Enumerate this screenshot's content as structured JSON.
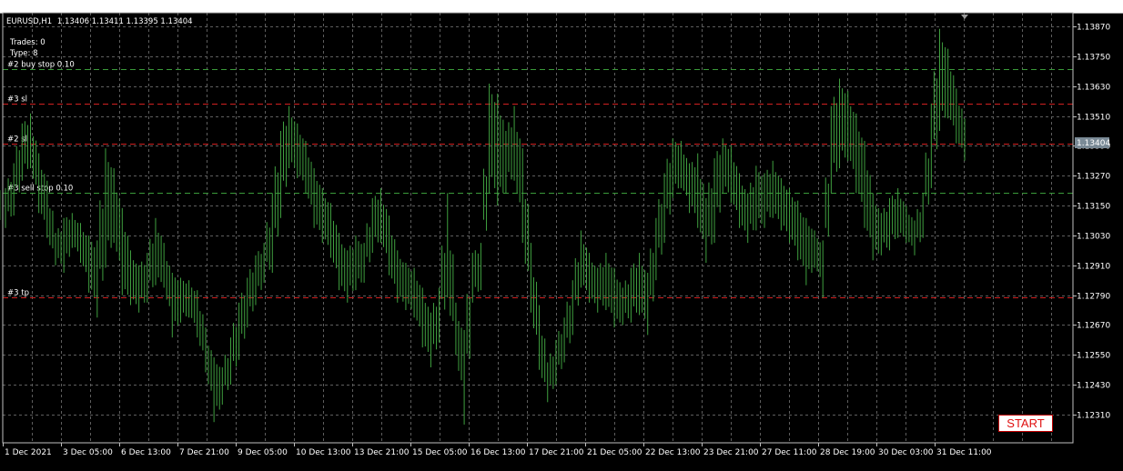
{
  "symbol_header": {
    "symbol": "EURUSD,H1",
    "ohlc": "1.13406 1.13411 1.13395 1.13404"
  },
  "info_lines": [
    "Trades: 0",
    "Type: 8"
  ],
  "levels": [
    {
      "label": "#2 buy stop 0.10",
      "price": 1.137,
      "color": "#3a9a3a",
      "show_label": true
    },
    {
      "label": "#3 sl",
      "price": 1.1356,
      "color": "#d02020",
      "show_label": true
    },
    {
      "label": "#2 sl",
      "price": 1.134,
      "color": "#d02020",
      "show_label": true
    },
    {
      "label": "#3 sell stop 0.10",
      "price": 1.132,
      "color": "#3a9a3a",
      "show_label": true
    },
    {
      "label": "#3 tp",
      "price": 1.1278,
      "color": "#d02020",
      "show_label": true
    }
  ],
  "price_axis": {
    "labels": [
      "1.13870",
      "1.13750",
      "1.13630",
      "1.13510",
      "1.13390",
      "1.13270",
      "1.13150",
      "1.13030",
      "1.12910",
      "1.12790",
      "1.12670",
      "1.12550",
      "1.12430",
      "1.12310"
    ],
    "current_price": "1.13404",
    "current_price_color": "#7a8a96"
  },
  "time_axis": {
    "labels": [
      "1 Dec 2021",
      "3 Dec 05:00",
      "6 Dec 13:00",
      "7 Dec 21:00",
      "9 Dec 05:00",
      "10 Dec 13:00",
      "13 Dec 21:00",
      "15 Dec 05:00",
      "16 Dec 13:00",
      "17 Dec 21:00",
      "21 Dec 05:00",
      "22 Dec 13:00",
      "23 Dec 21:00",
      "27 Dec 11:00",
      "28 Dec 19:00",
      "30 Dec 03:00",
      "31 Dec 11:00"
    ]
  },
  "colors": {
    "background": "#000000",
    "candle": "#3fa03f",
    "grid": "#5e5e5e",
    "text": "#ffffff"
  },
  "chart_data": {
    "type": "ohlc",
    "symbol": "EURUSD",
    "timeframe": "H1",
    "ylim": [
      1.1226,
      1.1391
    ],
    "bars_hl": [
      [
        1.1322,
        1.1306
      ],
      [
        1.1332,
        1.1311
      ],
      [
        1.1348,
        1.1325
      ],
      [
        1.1352,
        1.133
      ],
      [
        1.1336,
        1.1312
      ],
      [
        1.1325,
        1.1302
      ],
      [
        1.1304,
        1.1291
      ],
      [
        1.131,
        1.1288
      ],
      [
        1.1312,
        1.1298
      ],
      [
        1.1308,
        1.1292
      ],
      [
        1.1303,
        1.128
      ],
      [
        1.1301,
        1.127
      ],
      [
        1.1338,
        1.129
      ],
      [
        1.133,
        1.13
      ],
      [
        1.1314,
        1.1279
      ],
      [
        1.1297,
        1.1275
      ],
      [
        1.1291,
        1.1272
      ],
      [
        1.1296,
        1.1276
      ],
      [
        1.131,
        1.1283
      ],
      [
        1.13,
        1.1282
      ],
      [
        1.1288,
        1.1262
      ],
      [
        1.1286,
        1.1268
      ],
      [
        1.1285,
        1.127
      ],
      [
        1.1281,
        1.1262
      ],
      [
        1.1266,
        1.1248
      ],
      [
        1.1254,
        1.1228
      ],
      [
        1.125,
        1.1235
      ],
      [
        1.1262,
        1.1243
      ],
      [
        1.1276,
        1.1253
      ],
      [
        1.1286,
        1.1266
      ],
      [
        1.1295,
        1.1275
      ],
      [
        1.13,
        1.1284
      ],
      [
        1.132,
        1.1288
      ],
      [
        1.1345,
        1.131
      ],
      [
        1.1355,
        1.133
      ],
      [
        1.1348,
        1.1326
      ],
      [
        1.1341,
        1.132
      ],
      [
        1.133,
        1.1306
      ],
      [
        1.1322,
        1.13
      ],
      [
        1.1316,
        1.1294
      ],
      [
        1.1304,
        1.1281
      ],
      [
        1.1297,
        1.1276
      ],
      [
        1.1303,
        1.1281
      ],
      [
        1.13,
        1.1284
      ],
      [
        1.1318,
        1.1296
      ],
      [
        1.1322,
        1.13
      ],
      [
        1.1311,
        1.1287
      ],
      [
        1.1297,
        1.1276
      ],
      [
        1.1292,
        1.1273
      ],
      [
        1.129,
        1.127
      ],
      [
        1.1282,
        1.1258
      ],
      [
        1.1272,
        1.125
      ],
      [
        1.1282,
        1.126
      ],
      [
        1.132,
        1.1278
      ],
      [
        1.1276,
        1.1255
      ],
      [
        1.1265,
        1.1227
      ],
      [
        1.1296,
        1.1276
      ],
      [
        1.13,
        1.1281
      ],
      [
        1.1364,
        1.132
      ],
      [
        1.136,
        1.1315
      ],
      [
        1.1345,
        1.132
      ],
      [
        1.1355,
        1.1325
      ],
      [
        1.1338,
        1.13
      ],
      [
        1.13,
        1.1272
      ],
      [
        1.1275,
        1.1249
      ],
      [
        1.1252,
        1.1236
      ],
      [
        1.1261,
        1.1243
      ],
      [
        1.127,
        1.1252
      ],
      [
        1.1285,
        1.1263
      ],
      [
        1.1305,
        1.1282
      ],
      [
        1.1296,
        1.1276
      ],
      [
        1.129,
        1.1272
      ],
      [
        1.1296,
        1.1273
      ],
      [
        1.129,
        1.1266
      ],
      [
        1.1282,
        1.1267
      ],
      [
        1.129,
        1.1268
      ],
      [
        1.1296,
        1.1271
      ],
      [
        1.1288,
        1.1263
      ],
      [
        1.131,
        1.1285
      ],
      [
        1.1328,
        1.13
      ],
      [
        1.1342,
        1.1318
      ],
      [
        1.1341,
        1.1322
      ],
      [
        1.1332,
        1.1312
      ],
      [
        1.1336,
        1.1306
      ],
      [
        1.1318,
        1.1292
      ],
      [
        1.1334,
        1.13
      ],
      [
        1.1342,
        1.132
      ],
      [
        1.1339,
        1.1316
      ],
      [
        1.1328,
        1.1306
      ],
      [
        1.132,
        1.13
      ],
      [
        1.1331,
        1.1305
      ],
      [
        1.1328,
        1.1306
      ],
      [
        1.1333,
        1.131
      ],
      [
        1.1326,
        1.1305
      ],
      [
        1.1322,
        1.13
      ],
      [
        1.1317,
        1.1293
      ],
      [
        1.131,
        1.1283
      ],
      [
        1.1305,
        1.129
      ],
      [
        1.1301,
        1.1278
      ],
      [
        1.1355,
        1.132
      ],
      [
        1.1366,
        1.133
      ],
      [
        1.1361,
        1.1333
      ],
      [
        1.1352,
        1.132
      ],
      [
        1.1341,
        1.1306
      ],
      [
        1.132,
        1.1293
      ],
      [
        1.1312,
        1.1295
      ],
      [
        1.1318,
        1.1297
      ],
      [
        1.1322,
        1.1302
      ],
      [
        1.1315,
        1.13
      ],
      [
        1.1309,
        1.1295
      ],
      [
        1.132,
        1.1302
      ],
      [
        1.1356,
        1.1322
      ],
      [
        1.1386,
        1.1345
      ],
      [
        1.1378,
        1.135
      ],
      [
        1.1362,
        1.134
      ],
      [
        1.135,
        1.1333
      ]
    ]
  },
  "start_button": {
    "label": "START"
  }
}
